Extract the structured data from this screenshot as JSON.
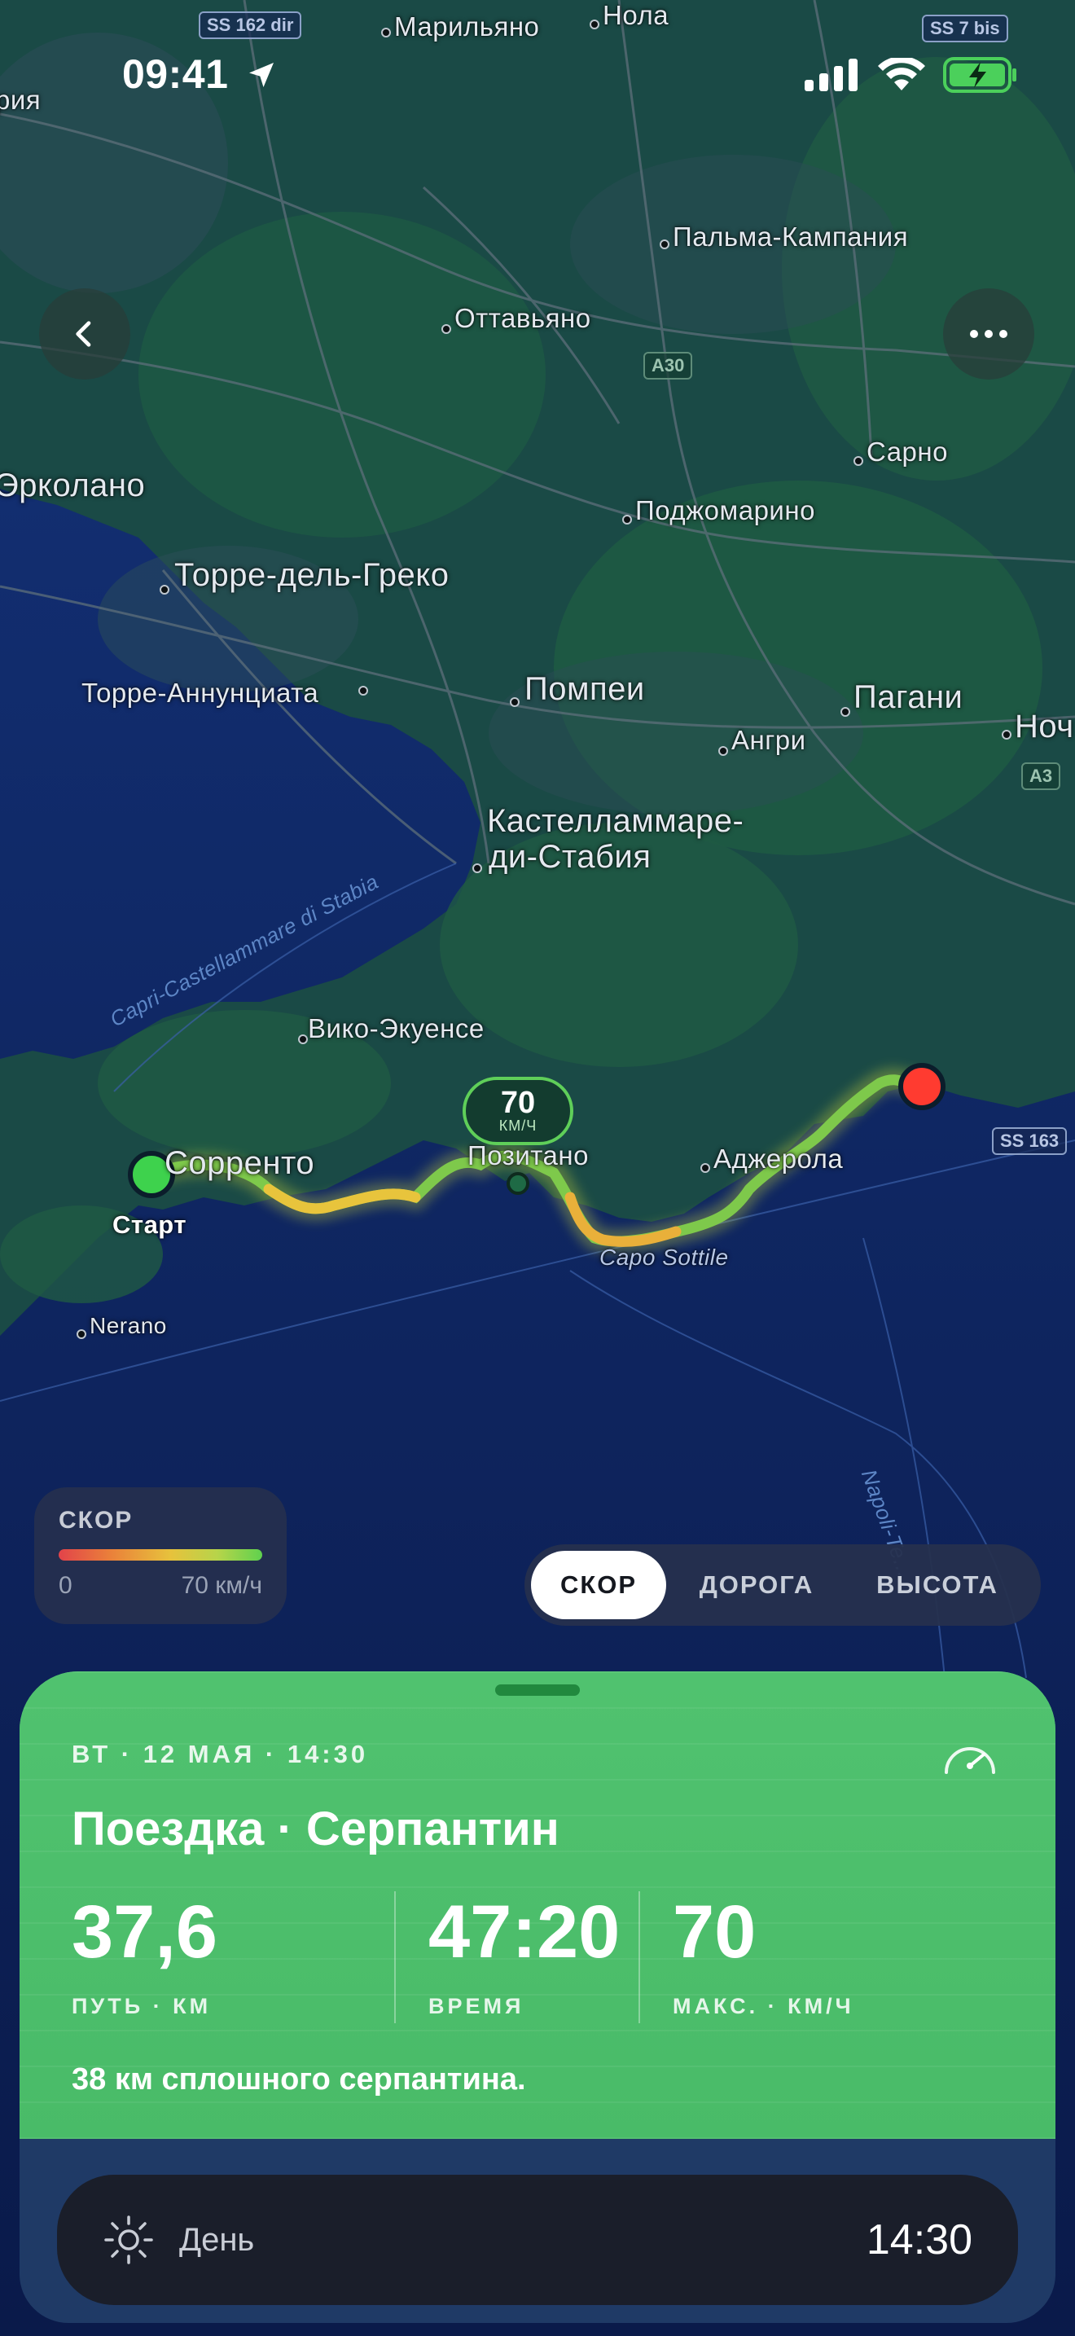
{
  "status_bar": {
    "time": "09:41"
  },
  "map": {
    "places": {
      "marilyano": "Марильяно",
      "nola": "Нола",
      "palma": "Пальма-Кампания",
      "ottaviano": "Оттавьяно",
      "sarno": "Сарно",
      "ercolano": "Эрколано",
      "podzhomarino": "Поджомарино",
      "torre_greco": "Торре-дель-Греко",
      "torre_ann": "Торре-Аннунциата",
      "pompei": "Помпеи",
      "pagani": "Пагани",
      "nocera": "Ноч",
      "angri": "Ангри",
      "castellammare": "Кастелламмаре-",
      "castellammare2": "ди-Стабия",
      "vico": "Вико-Экуенсе",
      "sorrento": "Сорренто",
      "positano": "Позитано",
      "agerola": "Аджерола",
      "capo": "Capo Sottile",
      "nerano": "Nerano",
      "partial_left": "рия",
      "ferry": "Capri-Castellammare di Stabia",
      "ferry2": "Napoli-Te..."
    },
    "roads": {
      "ss162": "SS 162 dir",
      "ss7": "SS 7 bis",
      "a30": "A30",
      "a3": "A3",
      "ss163": "SS 163"
    },
    "start_label": "Старт",
    "speed_marker": {
      "value": "70",
      "unit": "КМ/Ч"
    }
  },
  "legend": {
    "title": "СКОР",
    "min": "0",
    "max": "70 км/ч"
  },
  "segment": {
    "items": [
      "СКОР",
      "ДОРОГА",
      "ВЫСОТА"
    ],
    "active": 0
  },
  "card": {
    "date": "ВТ · 12 МАЯ · 14:30",
    "title": "Поездка · Серпантин",
    "stats": [
      {
        "value": "37,6",
        "label": "ПУТЬ · КМ"
      },
      {
        "value": "47:20",
        "label": "ВРЕМЯ"
      },
      {
        "value": "70",
        "label": "МАКС. · КМ/Ч"
      }
    ],
    "note": "38 км сплошного серпантина.",
    "day_label": "День",
    "day_time": "14:30"
  },
  "colors": {
    "card_green": "#4bbe6b",
    "start_green": "#3ed24d",
    "end_red": "#ff3b30",
    "route_yellow": "#e7c23c",
    "route_green": "#6cc94a"
  }
}
